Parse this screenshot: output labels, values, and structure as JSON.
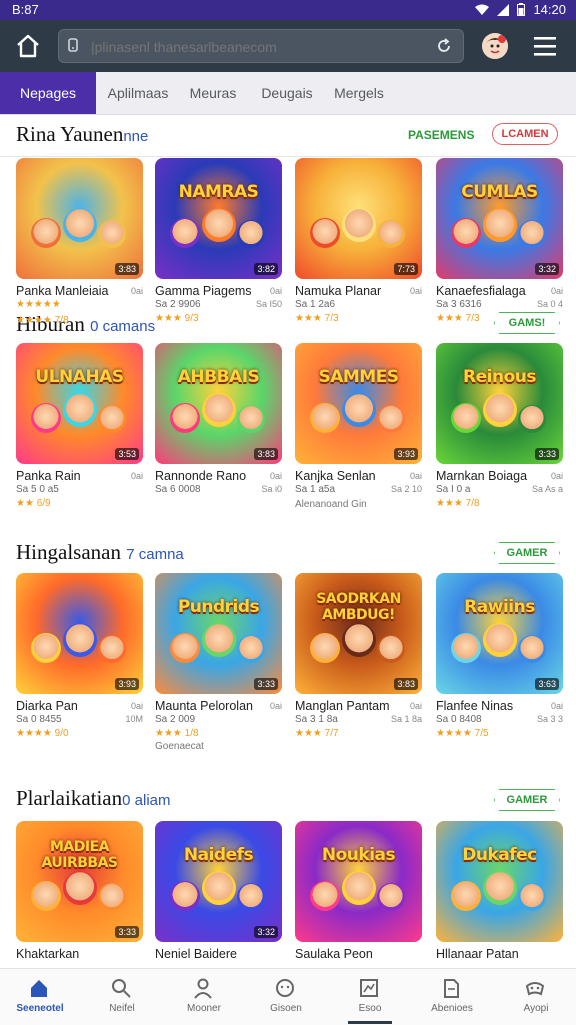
{
  "status": {
    "time": "B:87",
    "clock": "14:20"
  },
  "search": {
    "placeholder": "|plinasenl thanesarlbeanecom"
  },
  "tabs": [
    "Nepages",
    "Aplilmaas",
    "Meuras",
    "Deugais",
    "Mergels"
  ],
  "sections": [
    {
      "title": "Rina Yaunen",
      "subtitle": "nne",
      "link": "PASEMENS",
      "pill": "LCAMEN",
      "cards": [
        {
          "name": "Panka Manleiaia",
          "meta": "0ai",
          "sub": "",
          "sub_right": "",
          "rating": "★★★★★",
          "rating2": "★★★★ 7/8",
          "dur": "3:83",
          "art": "",
          "colors": [
            "#f2c24b",
            "#ef6f3b",
            "#4db3e6"
          ]
        },
        {
          "name": "Gamma Piagems",
          "meta": "0ai",
          "sub": "Sa 2 9906",
          "sub_right": "Sa I50",
          "rating": "★★★ 9/3",
          "dur": "3:82",
          "art": "NAMRAS",
          "colors": [
            "#2a3bb8",
            "#7a2fc8",
            "#ff7a2a"
          ]
        },
        {
          "name": "Namuka Planar",
          "meta": "0ai",
          "sub": "Sa 1 2a6",
          "sub_right": "",
          "rating": "★★★ 7/3",
          "dur": "7:73",
          "art": "",
          "colors": [
            "#f7b23a",
            "#ef4a2a",
            "#ffe07a"
          ]
        },
        {
          "name": "Kanaefesfialaga",
          "meta": "0ai",
          "sub": "Sa 3 6316",
          "sub_right": "Sa 0 4",
          "rating": "★★★ 7/3",
          "dur": "3:32",
          "art": "CUMLAS",
          "colors": [
            "#3a7ae6",
            "#e33a6a",
            "#ff9a2a"
          ]
        }
      ]
    },
    {
      "title": "Hiburan",
      "subtitle": "0 camans",
      "link": "",
      "pill": "GAMS!",
      "cards": [
        {
          "name": "Panka Rain",
          "meta": "0ai",
          "sub": "Sa 5 0 a5",
          "sub_right": "",
          "rating": "★★ 6/9",
          "dur": "3:53",
          "art": "ULNAHAS",
          "colors": [
            "#ff8a2a",
            "#ff3a8a",
            "#3ad6e6"
          ]
        },
        {
          "name": "Rannonde Rano",
          "meta": "0ai",
          "sub": "Sa 6 0008",
          "sub_right": "Sa i0",
          "rating": "",
          "dur": "3:83",
          "art": "AHBBAIS",
          "colors": [
            "#5ad66a",
            "#ff3a7a",
            "#ffd23a"
          ]
        },
        {
          "name": "Kanjka Senlan",
          "meta": "0ai",
          "sub": "Sa 1 a5a",
          "sub_right": "Sa 2 10",
          "rating": "",
          "extra": "Alenanoand Gin",
          "dur": "3:93",
          "art": "SAMMES",
          "colors": [
            "#ff7a3a",
            "#ffb23a",
            "#3a8ae6"
          ]
        },
        {
          "name": "Marnkan Boiaga",
          "meta": "0ai",
          "sub": "Sa I 0 a",
          "sub_right": "Sa As a",
          "rating": "★★★ 7/8",
          "dur": "3:33",
          "art": "Reinous",
          "colors": [
            "#2a8a3a",
            "#6ad63a",
            "#ffd23a"
          ]
        }
      ]
    },
    {
      "title": "Hingalsanan",
      "subtitle": "7 camna",
      "link": "",
      "pill": "GAMER",
      "cards": [
        {
          "name": "Diarka Pan",
          "meta": "0ai",
          "sub": "Sa 0 8455",
          "sub_right": "10M",
          "rating": "★★★★ 9/0",
          "dur": "3:93",
          "art": "",
          "colors": [
            "#ff6a2a",
            "#ffd23a",
            "#3a5ae6"
          ]
        },
        {
          "name": "Maunta Pelorolan",
          "meta": "0ai",
          "sub": "Sa 2 009",
          "sub_right": "",
          "rating": "★★★ 1/8",
          "extra": "Goenaecat",
          "dur": "3:33",
          "art": "Pundrids",
          "colors": [
            "#3aa6e6",
            "#ff8a3a",
            "#6ad66a"
          ]
        },
        {
          "name": "Manglan Pantam",
          "meta": "0ai",
          "sub": "Sa 3 1 8a",
          "sub_right": "Sa 1 8a",
          "rating": "★★★ 7/7",
          "dur": "3:83",
          "art": "SAODRKAN AMBDUG!",
          "colors": [
            "#c85a1a",
            "#ffb23a",
            "#6a2a1a"
          ]
        },
        {
          "name": "Flanfee Ninas",
          "meta": "0ai",
          "sub": "Sa 0 8408",
          "sub_right": "Sa 3 3",
          "rating": "★★★★ 7/5",
          "dur": "3:63",
          "art": "Rawiins",
          "colors": [
            "#3a8ae6",
            "#6ad6e6",
            "#ffd23a"
          ]
        }
      ]
    },
    {
      "title": "Plarlaikatian",
      "subtitle": "0 aliam",
      "link": "",
      "pill": "GAMER",
      "cards": [
        {
          "name": "Khaktarkan",
          "meta": "",
          "sub": "",
          "sub_right": "",
          "rating": "",
          "dur": "3:33",
          "art": "MADIEA AUIRBBAS",
          "colors": [
            "#ff8a2a",
            "#ffb23a",
            "#e63a3a"
          ]
        },
        {
          "name": "Neniel Baidere",
          "meta": "",
          "sub": "",
          "sub_right": "",
          "rating": "",
          "dur": "3:32",
          "art": "Naidefs",
          "colors": [
            "#3a4ae6",
            "#7a2fc8",
            "#ffd23a"
          ]
        },
        {
          "name": "Saulaka Peon",
          "meta": "",
          "sub": "",
          "sub_right": "",
          "rating": "",
          "dur": "",
          "art": "Noukias",
          "colors": [
            "#8a2ac8",
            "#ff3a8a",
            "#ffd23a"
          ]
        },
        {
          "name": "Hllanaar Patan",
          "meta": "",
          "sub": "",
          "sub_right": "",
          "rating": "",
          "dur": "",
          "art": "Dukafec",
          "colors": [
            "#3aa6e6",
            "#ffb23a",
            "#6ad66a"
          ]
        }
      ]
    }
  ],
  "bottom_nav": [
    {
      "label": "Seeneotel",
      "icon": "home-icon",
      "active": true
    },
    {
      "label": "Neifel",
      "icon": "search-icon",
      "active": false
    },
    {
      "label": "Mooner",
      "icon": "user-icon",
      "active": false
    },
    {
      "label": "Gisoen",
      "icon": "globe-icon",
      "active": false
    },
    {
      "label": "Esoo",
      "icon": "window-icon",
      "active": false
    },
    {
      "label": "Abenioes",
      "icon": "doc-icon",
      "active": false
    },
    {
      "label": "Ayopi",
      "icon": "gamepad-icon",
      "active": false
    }
  ],
  "colors": {
    "brand": "#4a2fa8",
    "appbar": "#2e3a45",
    "status": "#3a2a8c",
    "accent_link": "#2b55b8"
  }
}
